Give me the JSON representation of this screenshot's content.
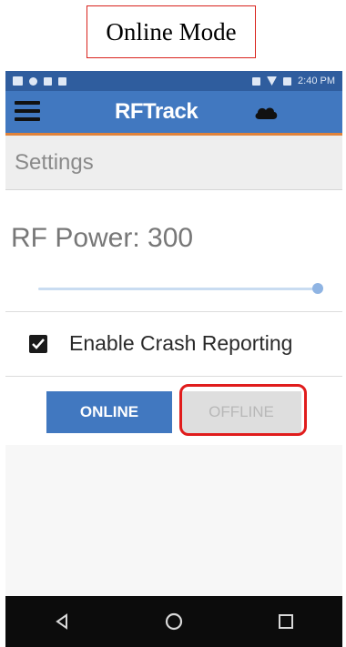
{
  "caption": "Online Mode",
  "status_bar": {
    "time": "2:40 PM",
    "left_icons": [
      "image-icon",
      "location-icon",
      "nfc-icon",
      "sd-icon"
    ],
    "right_icons": [
      "bluetooth-icon",
      "wifi-icon",
      "battery-icon"
    ]
  },
  "app_bar": {
    "title": "RFTrack",
    "menu_icon": "hamburger-icon",
    "status_icon": "cloud-icon"
  },
  "settings": {
    "header": "Settings",
    "rf_power_label": "RF Power: 300",
    "rf_power_level": 1.0,
    "crash_reporting": {
      "label": "Enable Crash Reporting",
      "checked": true
    },
    "mode": {
      "online_label": "ONLINE",
      "offline_label": "OFFLINE",
      "selected": "ONLINE"
    }
  },
  "nav": {
    "back_icon": "back-triangle-icon",
    "home_icon": "home-circle-icon",
    "recents_icon": "recents-square-icon"
  },
  "colors": {
    "app_bar": "#4178c0",
    "status_bar": "#2f5d9e",
    "accent_stripe": "#e0833a",
    "highlight": "#e01c1c"
  }
}
